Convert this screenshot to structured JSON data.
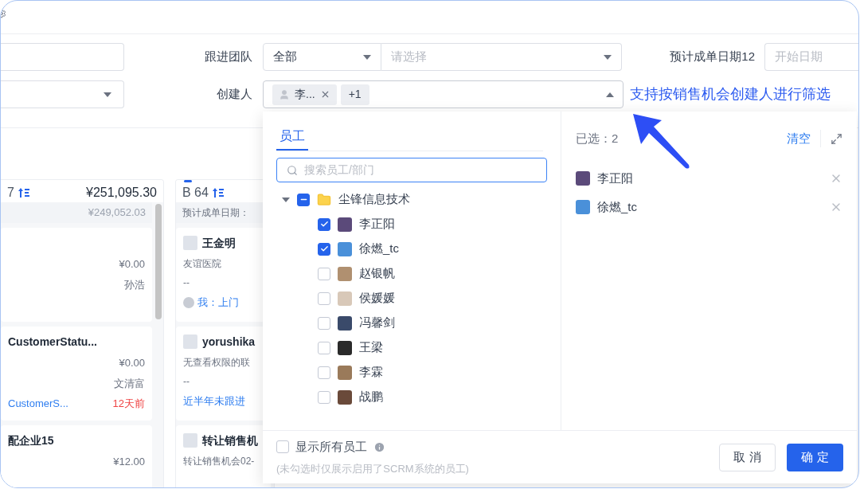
{
  "filters": {
    "row1": {
      "team_label": "跟进团队",
      "team_scope": "全部",
      "team_placeholder": "请选择",
      "date_label": "预计成单日期12",
      "date_placeholder": "开始日期"
    },
    "row2": {
      "creator_label": "创建人",
      "tags": [
        {
          "kind": "person",
          "text": "李..."
        },
        {
          "kind": "count",
          "text": "+1"
        }
      ],
      "expanded": true
    },
    "annotation": "支持按销售机会创建人进行筛选"
  },
  "columns": [
    {
      "title": "7",
      "total": "¥251,095.30",
      "stripe_right": "¥249,052.03",
      "active": false,
      "cards": [
        {
          "items": [
            {
              "kind": "right",
              "text": "¥0.00"
            },
            {
              "kind": "right",
              "text": "孙浩"
            }
          ]
        },
        {
          "title": "CustomerStatu...",
          "items": [
            {
              "kind": "right",
              "text": "¥0.00"
            },
            {
              "kind": "right",
              "text": "文清富"
            },
            {
              "kind": "footer",
              "text": "CustomerS...",
              "extra": "12天前"
            }
          ]
        },
        {
          "title": "配企业15",
          "items": [
            {
              "kind": "right",
              "text": "¥12.00"
            }
          ]
        }
      ]
    },
    {
      "title": "B 64",
      "stripe_left": "预计成单日期：",
      "active": true,
      "cards": [
        {
          "title": "王金明",
          "items": [
            {
              "kind": "left",
              "text": "友谊医院"
            },
            {
              "kind": "left",
              "text": "--"
            },
            {
              "kind": "activity",
              "text": "我：上门"
            }
          ]
        },
        {
          "title": "yorushika",
          "items": [
            {
              "kind": "left",
              "text": "无查看权限的联"
            },
            {
              "kind": "left",
              "text": "--"
            },
            {
              "kind": "link",
              "text": "近半年未跟进"
            }
          ]
        },
        {
          "title": "转让销售机",
          "items": [
            {
              "kind": "left",
              "text": "转让销售机会02-"
            }
          ]
        }
      ]
    }
  ],
  "picker": {
    "tabs": [
      {
        "label": "员工",
        "selected": true
      }
    ],
    "search_placeholder": "搜索员工/部门",
    "tree": [
      {
        "label": "尘锋信息技术",
        "expanded": true,
        "checked": false,
        "indeterminate": true,
        "children": [
          {
            "label": "李正阳",
            "checked": true
          },
          {
            "label": "徐燃_tc",
            "checked": true
          },
          {
            "label": "赵银帆",
            "checked": false
          },
          {
            "label": "侯媛媛",
            "checked": false
          },
          {
            "label": "冯馨剑",
            "checked": false
          },
          {
            "label": "王梁",
            "checked": false
          },
          {
            "label": "李霖",
            "checked": false
          },
          {
            "label": "战鹏",
            "checked": false
          }
        ]
      }
    ],
    "selected_label": "已选：2",
    "clear": "清空",
    "selected": [
      {
        "label": "李正阳"
      },
      {
        "label": "徐燃_tc"
      }
    ],
    "show_all": {
      "label": "显示所有员工",
      "checked": false,
      "hint": "(未勾选时仅展示启用了SCRM系统的员工)"
    },
    "buttons": [
      {
        "label": "取 消",
        "kind": "secondary"
      },
      {
        "label": "确 定",
        "kind": "primary"
      }
    ]
  }
}
